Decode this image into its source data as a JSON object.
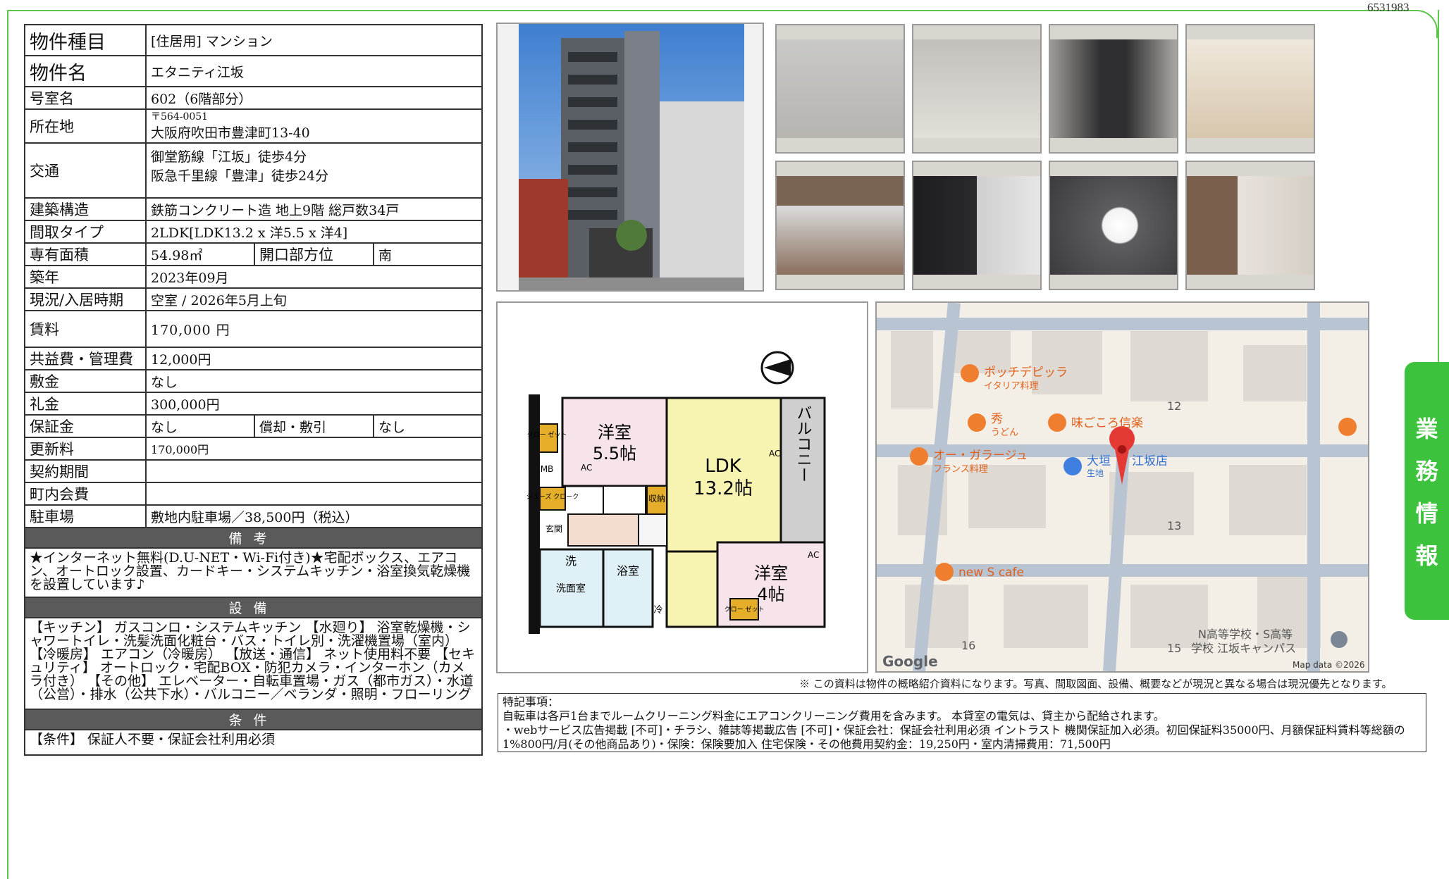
{
  "doc_id": "6531983",
  "side_tab": [
    "業",
    "務",
    "情",
    "報"
  ],
  "rows": {
    "type_label": "物件種目",
    "type_value": "[住居用]  マンション",
    "name_label": "物件名",
    "name_value": "エタニティ江坂",
    "room_label": "号室名",
    "room_value": "602（6階部分）",
    "address_label": "所在地",
    "postal": "〒564-0051",
    "address": "大阪府吹田市豊津町13-40",
    "transport_label": "交通",
    "transport_1": "御堂筋線「江坂」徒歩4分",
    "transport_2": "阪急千里線「豊津」徒歩24分",
    "structure_label": "建築構造",
    "structure_value": "鉄筋コンクリート造 地上9階 総戸数34戸",
    "layout_label": "間取タイプ",
    "layout_value": "2LDK[LDK13.2 x 洋5.5 x 洋4]",
    "area_label": "専有面積",
    "area_value": "54.98㎡",
    "direction_label": "開口部方位",
    "direction_value": "南",
    "built_label": "築年",
    "built_value": "2023年09月",
    "status_label": "現況/入居時期",
    "status_value": "空室 /  2026年5月上旬",
    "rent_label": "賃料",
    "rent_value": "170,000 円",
    "fee_label": "共益費・管理費",
    "fee_value": "12,000円",
    "deposit_label": "敷金",
    "deposit_value": "なし",
    "key_money_label": "礼金",
    "key_money_value": "300,000円",
    "guarantee_label": "保証金",
    "guarantee_value": "なし",
    "amort_label": "償却・敷引",
    "amort_value": "なし",
    "renewal_label": "更新料",
    "renewal_value": "170,000円",
    "contract_label": "契約期間",
    "contract_value": "",
    "community_label": "町内会費",
    "community_value": "",
    "parking_label": "駐車場",
    "parking_value": "敷地内駐車場／38,500円（税込）"
  },
  "remarks_title": "備考",
  "remarks_text": "★インターネット無料(D.U-NET・Wi-Fi付き)★宅配ボックス、エアコン、オートロック設置、カードキー・システムキッチン・浴室換気乾燥機を設置しています♪",
  "equipment_title": "設備",
  "equipment_text": "【キッチン】 ガスコンロ・システムキッチン 【水廻り】 浴室乾燥機・シャワートイレ・洗髪洗面化粧台・バス・トイレ別・洗濯機置場（室内） 【冷暖房】 エアコン（冷暖房） 【放送・通信】 ネット使用料不要 【セキュリティ】 オートロック・宅配BOX・防犯カメラ・インターホン（カメラ付き） 【その他】 エレベーター・自転車置場・ガス（都市ガス）・水道（公営）・排水（公共下水）・バルコニー／ベランダ・照明・フローリング",
  "conditions_title": "条件",
  "conditions_text": "【条件】 保証人不要・保証会社利用必須",
  "floorplan": {
    "room1": "洋室",
    "room1_size": "5.5帖",
    "ldk": "LDK",
    "ldk_size": "13.2帖",
    "room2": "洋室",
    "room2_size": "4帖",
    "balcony": "バルコニー",
    "closet": "クロー ゼット",
    "shoes": "シューズ クローク",
    "storage": "収納",
    "entry": "玄関",
    "wash": "洗",
    "washroom": "洗面室",
    "bath": "浴室",
    "mb": "MB",
    "ac": "AC",
    "fridge": "冷"
  },
  "map": {
    "poi_1": "ポッチデピッラ",
    "poi_1_sub": "イタリア料理",
    "poi_2": "秀",
    "poi_2_sub": "うどん",
    "poi_3": "味ごころ信楽",
    "poi_4": "オー・ガラージュ",
    "poi_4_sub": "フランス料理",
    "poi_5": "大垣",
    "poi_5_sub": "生地",
    "poi_5b": "江坂店",
    "poi_6": "new S cafe",
    "poi_7": "N高等学校・S高等",
    "poi_7b": "学校 江坂キャンパス",
    "block_12": "12",
    "block_13": "13",
    "block_15": "15",
    "block_16": "16",
    "google": "Google",
    "attribution": "Map data ©2026"
  },
  "disclaimer": "※ この資料は物件の概略紹介資料になります。写真、間取図面、設備、概要などが現況と異なる場合は現況優先となります。",
  "notes_title": "特記事項：",
  "notes_line1": "自転車は各戸1台までルームクリーニング料金にエアコンクリーニング費用を含みます。  本貸室の電気は、貸主から配給されます。",
  "notes_line2": "・webサービス広告掲載 [不可]・チラシ、雑誌等掲載広告 [不可]・保証会社：保証会社利用必須 イントラスト 機関保証加入必須。初回保証料35000円、月額保証料賃料等総額の1%800円/月(その他商品あり)・保険：保険要加入 住宅保険・その他費用契約金：19,250円・室内清掃費用：71,500円"
}
